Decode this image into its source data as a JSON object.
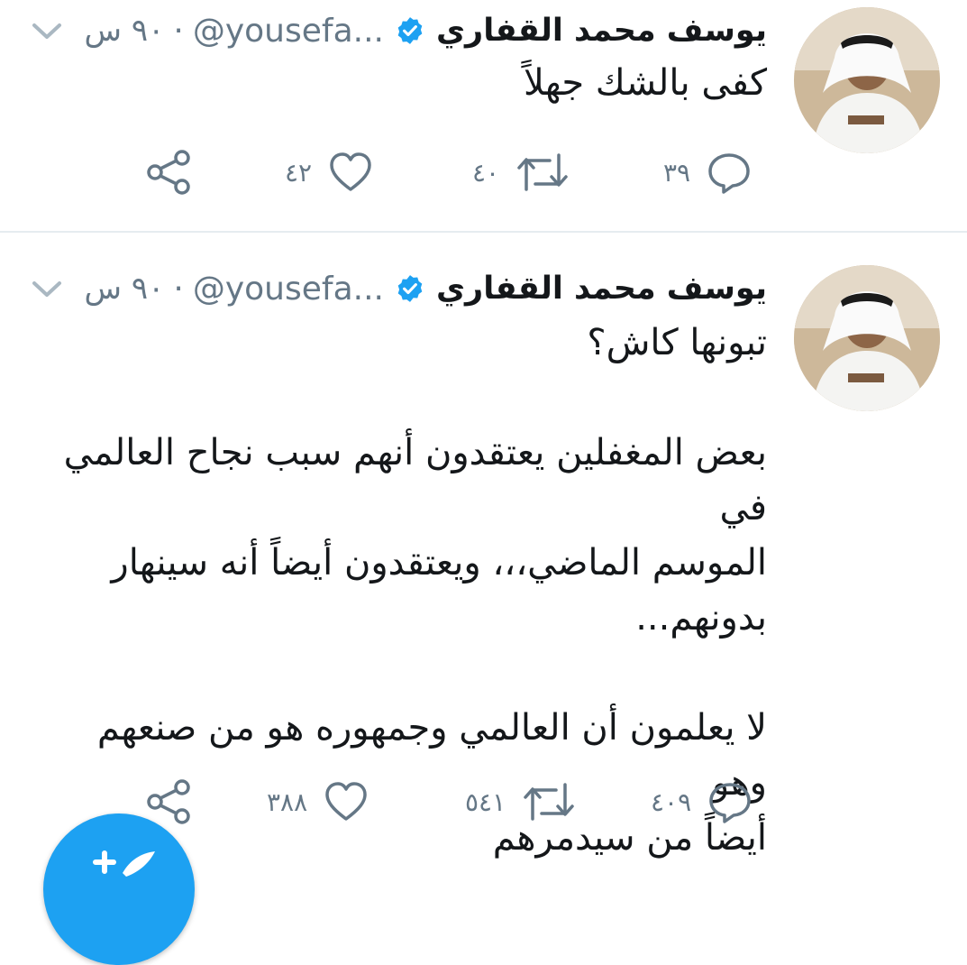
{
  "colors": {
    "accent": "#1da1f2",
    "muted": "#657786",
    "text": "#14171a",
    "divider": "#e6ecf0"
  },
  "tweets": [
    {
      "author_name": "يوسف محمد القفاري",
      "handle": "@yousefa...",
      "separator": "·",
      "time": "٩٠ س",
      "text": [
        "كفى بالشك جهلاً"
      ],
      "replies": "٣٩",
      "retweets": "٤٠",
      "likes": "٤٢"
    },
    {
      "author_name": "يوسف محمد القفاري",
      "handle": "@yousefa...",
      "separator": "·",
      "time": "٩٠ س",
      "text": [
        "تبونها كاش؟",
        "",
        "بعض المغفلين يعتقدون أنهم سبب نجاح العالمي في",
        "الموسم الماضي،،، ويعتقدون أيضاً أنه سينهار",
        "بدونهم...",
        "",
        "لا يعلمون أن العالمي وجمهوره هو من صنعهم وهو",
        "أيضاً من سيدمرهم"
      ],
      "replies": "٤٠٩",
      "retweets": "٥٤١",
      "likes": "٣٨٨"
    }
  ],
  "icons": {
    "verified": "verified-badge-icon",
    "more": "chevron-down-icon",
    "reply": "reply-icon",
    "retweet": "retweet-icon",
    "like": "heart-icon",
    "share": "share-icon",
    "compose": "compose-tweet-icon"
  }
}
